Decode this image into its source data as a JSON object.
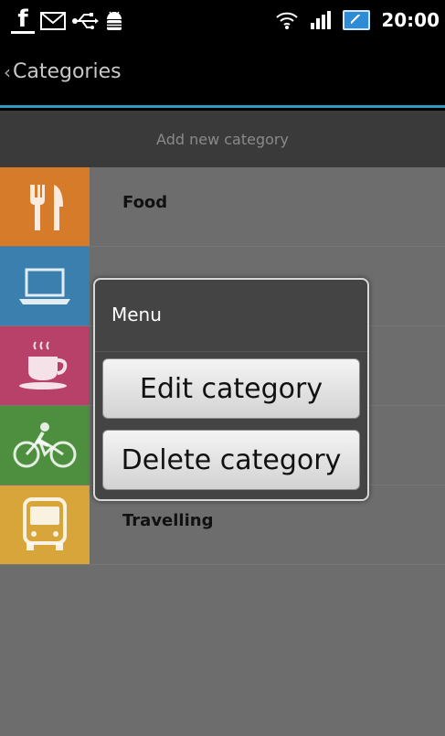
{
  "status_bar": {
    "time": "20:00",
    "icons": [
      "facebook-icon",
      "gmail-icon",
      "usb-icon",
      "android-debug-icon",
      "wifi-icon",
      "signal-icon",
      "battery-icon"
    ]
  },
  "title_bar": {
    "title": "Categories"
  },
  "add_category": {
    "label": "Add new category"
  },
  "categories": [
    {
      "label": "Food",
      "color": "#d57b2a",
      "icon": "fork-knife-icon"
    },
    {
      "label": "",
      "color": "#3b7fae",
      "icon": "laptop-icon"
    },
    {
      "label": "",
      "color": "#b8416a",
      "icon": "coffee-cup-icon"
    },
    {
      "label": "",
      "color": "#4e8f3f",
      "icon": "bicycle-icon"
    },
    {
      "label": "Travelling",
      "color": "#d7a53a",
      "icon": "bus-icon"
    }
  ],
  "dialog": {
    "title": "Menu",
    "buttons": [
      {
        "label": "Edit category"
      },
      {
        "label": "Delete category"
      }
    ]
  },
  "colors": {
    "accent": "#2b9bc0",
    "list_bg": "#6d6d6d",
    "add_bar_bg": "#3a3a3a"
  }
}
